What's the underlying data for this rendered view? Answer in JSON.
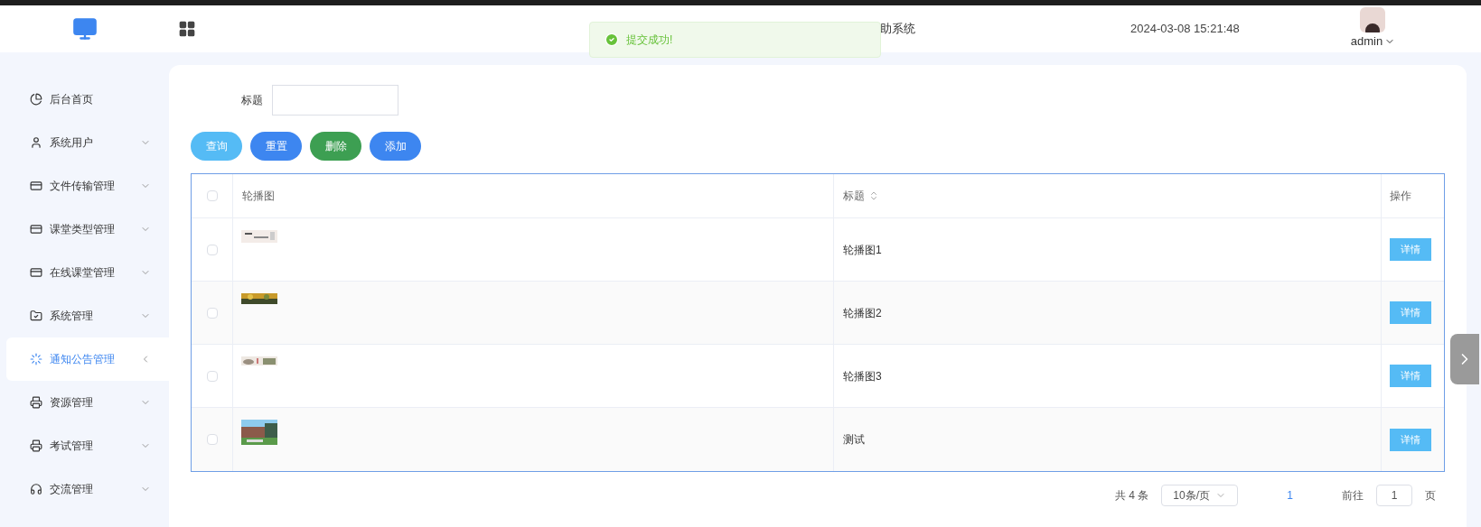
{
  "header": {
    "title": "助系统",
    "datetime": "2024-03-08 15:21:48",
    "user": "admin"
  },
  "toast": {
    "message": "提交成功!"
  },
  "sidebar": {
    "items": [
      {
        "label": "后台首页",
        "expandable": false,
        "selected": false
      },
      {
        "label": "系统用户",
        "expandable": true,
        "selected": false
      },
      {
        "label": "文件传输管理",
        "expandable": true,
        "selected": false
      },
      {
        "label": "课堂类型管理",
        "expandable": true,
        "selected": false
      },
      {
        "label": "在线课堂管理",
        "expandable": true,
        "selected": false
      },
      {
        "label": "系统管理",
        "expandable": true,
        "selected": false
      },
      {
        "label": "通知公告管理",
        "expandable": true,
        "selected": true
      },
      {
        "label": "资源管理",
        "expandable": true,
        "selected": false
      },
      {
        "label": "考试管理",
        "expandable": true,
        "selected": false
      },
      {
        "label": "交流管理",
        "expandable": true,
        "selected": false
      }
    ]
  },
  "filter": {
    "label": "标题"
  },
  "buttons": [
    {
      "label": "查询",
      "color": "#55bbf5"
    },
    {
      "label": "重置",
      "color": "#3d86f0"
    },
    {
      "label": "删除",
      "color": "#3d9f52"
    },
    {
      "label": "添加",
      "color": "#3d86f0"
    }
  ],
  "table": {
    "select_all_checked": false,
    "columns": [
      "轮播图",
      "标题",
      "操作"
    ],
    "rows": [
      {
        "checked": false,
        "title": "轮播图1",
        "action": "详情"
      },
      {
        "checked": false,
        "title": "轮播图2",
        "action": "详情"
      },
      {
        "checked": false,
        "title": "轮播图3",
        "action": "详情"
      },
      {
        "checked": false,
        "title": "测试",
        "action": "详情"
      }
    ]
  },
  "pagination": {
    "total": "共 4 条",
    "page_size": "10条/页",
    "current": "1",
    "goto_label": "前往",
    "goto_value": "1",
    "page_suffix": "页"
  }
}
